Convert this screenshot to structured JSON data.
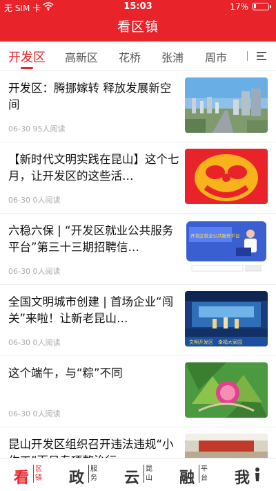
{
  "status_bar": {
    "carrier": "无 SIM 卡",
    "time": "15:03",
    "battery": "17%",
    "battery_level": 0.17
  },
  "header": {
    "title": "看区镇"
  },
  "tabs": [
    {
      "label": "开发区",
      "active": true
    },
    {
      "label": "高新区"
    },
    {
      "label": "花桥"
    },
    {
      "label": "张浦"
    },
    {
      "label": "周市"
    }
  ],
  "articles": [
    {
      "title": "开发区：腾挪嫁转 释放发展新空间",
      "meta": "06-30 95人阅读",
      "thumb": "city-skyline"
    },
    {
      "title": "【新时代文明实践在昆山】这个七月，让开发区的这些活…",
      "meta": "06-30 0人阅读",
      "thumb": "civilization-logo"
    },
    {
      "title": "六稳六保 | “开发区就业公共服务平台”第三十三期招聘信…",
      "meta": "06-30 0人阅读",
      "thumb": "job-platform",
      "thumb_caption": "开发区就业公共服务平台"
    },
    {
      "title": "全国文明城市创建 | 首场企业“闯关”来啦！让新老昆山…",
      "meta": "06-30 0人阅读",
      "thumb": "stage-event",
      "thumb_caption": "文明开发区　幸福大家园"
    },
    {
      "title": "这个端午，与“粽”不同",
      "meta": "06-30 0人阅读",
      "thumb": "zongzi"
    },
    {
      "title": "昆山开发区组织召开违法违规“小作工”百日专项整治行…",
      "meta": "",
      "thumb": "meeting-room"
    }
  ],
  "bottom_nav": [
    {
      "big": "看",
      "small": "区镇",
      "active": true
    },
    {
      "big": "政",
      "small": "服务"
    },
    {
      "big": "云",
      "small": "昆山"
    },
    {
      "big": "融",
      "small": "平台"
    },
    {
      "big": "我",
      "small": "",
      "icon": "person-icon"
    }
  ],
  "colors": {
    "brand": "#e8232a"
  }
}
